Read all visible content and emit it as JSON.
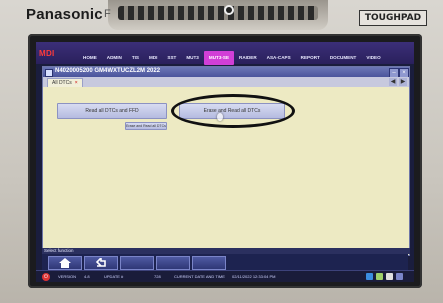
{
  "device": {
    "brand": "Panasonic",
    "brand_suffix": "F",
    "model_badge": "TOUGHPAD"
  },
  "app": {
    "logo": "MDI",
    "nav_tabs": [
      {
        "label": "HOME",
        "active": false
      },
      {
        "label": "ADMIN",
        "active": false
      },
      {
        "label": "TIS",
        "active": false
      },
      {
        "label": "MDI",
        "active": false
      },
      {
        "label": "SST",
        "active": false
      },
      {
        "label": "MUT3",
        "active": false
      },
      {
        "label": "MUT3-SE",
        "active": true
      },
      {
        "label": "RAIDER",
        "active": false
      },
      {
        "label": "ASA-CAPS",
        "active": false
      },
      {
        "label": "REPORT",
        "active": false
      },
      {
        "label": "DOCUMENT",
        "active": false
      },
      {
        "label": "VIDEO",
        "active": false
      }
    ]
  },
  "window": {
    "title": "N4020005200  GM4WXTUCZL2M 2022",
    "tab_label": "All DTCs",
    "read_button": "Read all DTCs and FFD",
    "erase_button": "Erase and Read all DTCs",
    "erase_small": "Erase and Read all DTCs"
  },
  "bottom": {
    "select_function": "Select function"
  },
  "status": {
    "version_label": "VERSION",
    "version_value": "4.8",
    "update_label": "UPDATE #",
    "update_value": "728",
    "datetime_label": "CURRENT DATE AND TIME",
    "datetime_value": "02/11/2022 12:33:04 PM"
  },
  "colors": {
    "accent_tab": "#d13fd7",
    "window_bg": "#edeac3",
    "nav_bg": "#2a205c"
  }
}
